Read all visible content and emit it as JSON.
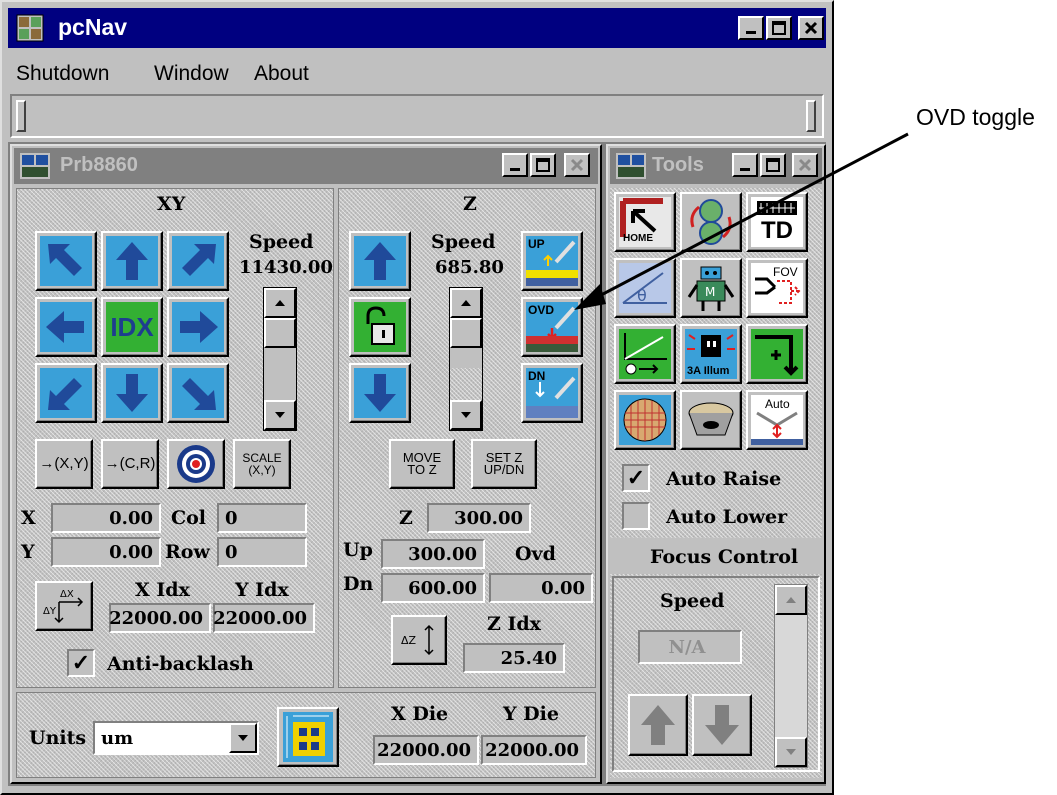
{
  "main_window": {
    "title": "pcNav",
    "menu": [
      "Shutdown",
      "Window",
      "About"
    ]
  },
  "annotation": {
    "label": "OVD toggle"
  },
  "prober": {
    "title": "Prb8860",
    "xy": {
      "section_label": "XY",
      "speed_label": "Speed",
      "speed_value": "11430.00",
      "center_label": "IDX",
      "buttons": [
        "→(X,Y)",
        "→(C,R)",
        "SCALE\n(X,Y)"
      ],
      "x_label": "X",
      "x_value": "0.00",
      "col_label": "Col",
      "col_value": "0",
      "y_label": "Y",
      "y_value": "0.00",
      "row_label": "Row",
      "row_value": "0",
      "xidx_label": "X Idx",
      "xidx_value": "22000.00",
      "yidx_label": "Y Idx",
      "yidx_value": "22000.00",
      "anti_backlash_label": "Anti-backlash",
      "anti_backlash_checked": true
    },
    "z": {
      "section_label": "Z",
      "speed_label": "Speed",
      "speed_value": "685.80",
      "up_tile_label": "UP",
      "ovd_tile_label": "OVD",
      "dn_tile_label": "DN",
      "move_to_z": "MOVE\nTO Z",
      "set_z": "SET Z\nUP/DN",
      "z_label": "Z",
      "z_value": "300.00",
      "up_label": "Up",
      "up_value": "300.00",
      "ovd_label": "Ovd",
      "ovd_value": "0.00",
      "dn_label": "Dn",
      "dn_value": "600.00",
      "zidx_label": "Z Idx",
      "zidx_value": "25.40"
    },
    "bottom": {
      "units_label": "Units",
      "units_value": "um",
      "xdie_label": "X Die",
      "xdie_value": "22000.00",
      "ydie_label": "Y Die",
      "ydie_value": "22000.00"
    }
  },
  "tools": {
    "title": "Tools",
    "tile_labels": {
      "home": "HOME",
      "td": "TD",
      "fov": "FOV",
      "illum": "3A Illum",
      "auto": "Auto"
    },
    "auto_raise_label": "Auto Raise",
    "auto_raise_checked": true,
    "auto_lower_label": "Auto Lower",
    "auto_lower_checked": false,
    "focus_control_label": "Focus Control",
    "speed_label": "Speed",
    "speed_value": "N/A"
  },
  "colors": {
    "active_title": "#000080",
    "inactive_title": "#808080",
    "tile_blue": "#3aa0d8",
    "tile_green": "#33b033"
  }
}
